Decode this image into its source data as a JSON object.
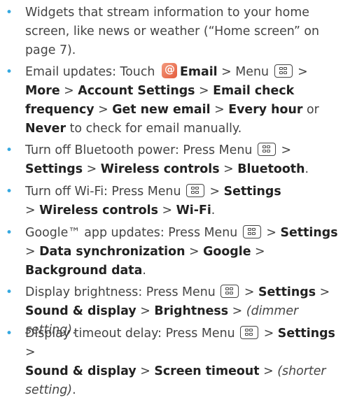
{
  "colors": {
    "bullet": "#35a8e0",
    "text": "#444444",
    "bold": "#222222"
  },
  "icons": {
    "menu_key": "menu-key-icon",
    "email_app": "email-app-icon"
  },
  "items": [
    {
      "text": "Widgets that stream information to your home screen, like news or weather (“Home screen” on page 7)."
    },
    {
      "t0": "Email updates: Touch",
      "b0": "Email",
      "t1": "> Menu",
      "t2": ">",
      "b1": "More",
      "t3": ">",
      "b2": "Account Settings",
      "t4": ">",
      "b3": "Email check frequency",
      "t5": ">",
      "b4": "Get new email",
      "t6": ">",
      "b5": "Every hour",
      "t7": "or",
      "b6": "Never",
      "t8": "to check for email manually."
    },
    {
      "t0": "Turn off Bluetooth power: Press Menu",
      "t1": ">",
      "b0": "Settings",
      "t2": ">",
      "b1": "Wireless controls",
      "t3": ">",
      "b2": "Bluetooth",
      "t4": "."
    },
    {
      "t0": "Turn off Wi-Fi: Press Menu",
      "t1": ">",
      "b0": "Settings",
      "t2": ">",
      "b1": "Wireless controls",
      "t3": ">",
      "b2": "Wi-Fi",
      "t4": "."
    },
    {
      "t0": "Google™ app updates: Press Menu",
      "t1": ">",
      "b0": "Settings",
      "t2": ">",
      "b1": "Data synchronization",
      "t3": ">",
      "b2": "Google",
      "t4": ">",
      "b3": "Background data",
      "t5": "."
    },
    {
      "t0": "Display brightness: Press Menu",
      "t1": ">",
      "b0": "Settings",
      "t2": ">",
      "b1": "Sound & display",
      "t3": ">",
      "b2": "Brightness",
      "t4": ">",
      "i0": "(dimmer setting)",
      "t5": "."
    },
    {
      "t0": "Display timeout delay: Press Menu",
      "t1": ">",
      "b0": "Settings",
      "t2": ">",
      "b1": "Sound & display",
      "t3": ">",
      "b2": "Screen timeout",
      "t4": ">",
      "i0": "(shorter setting)",
      "t5": "."
    }
  ]
}
